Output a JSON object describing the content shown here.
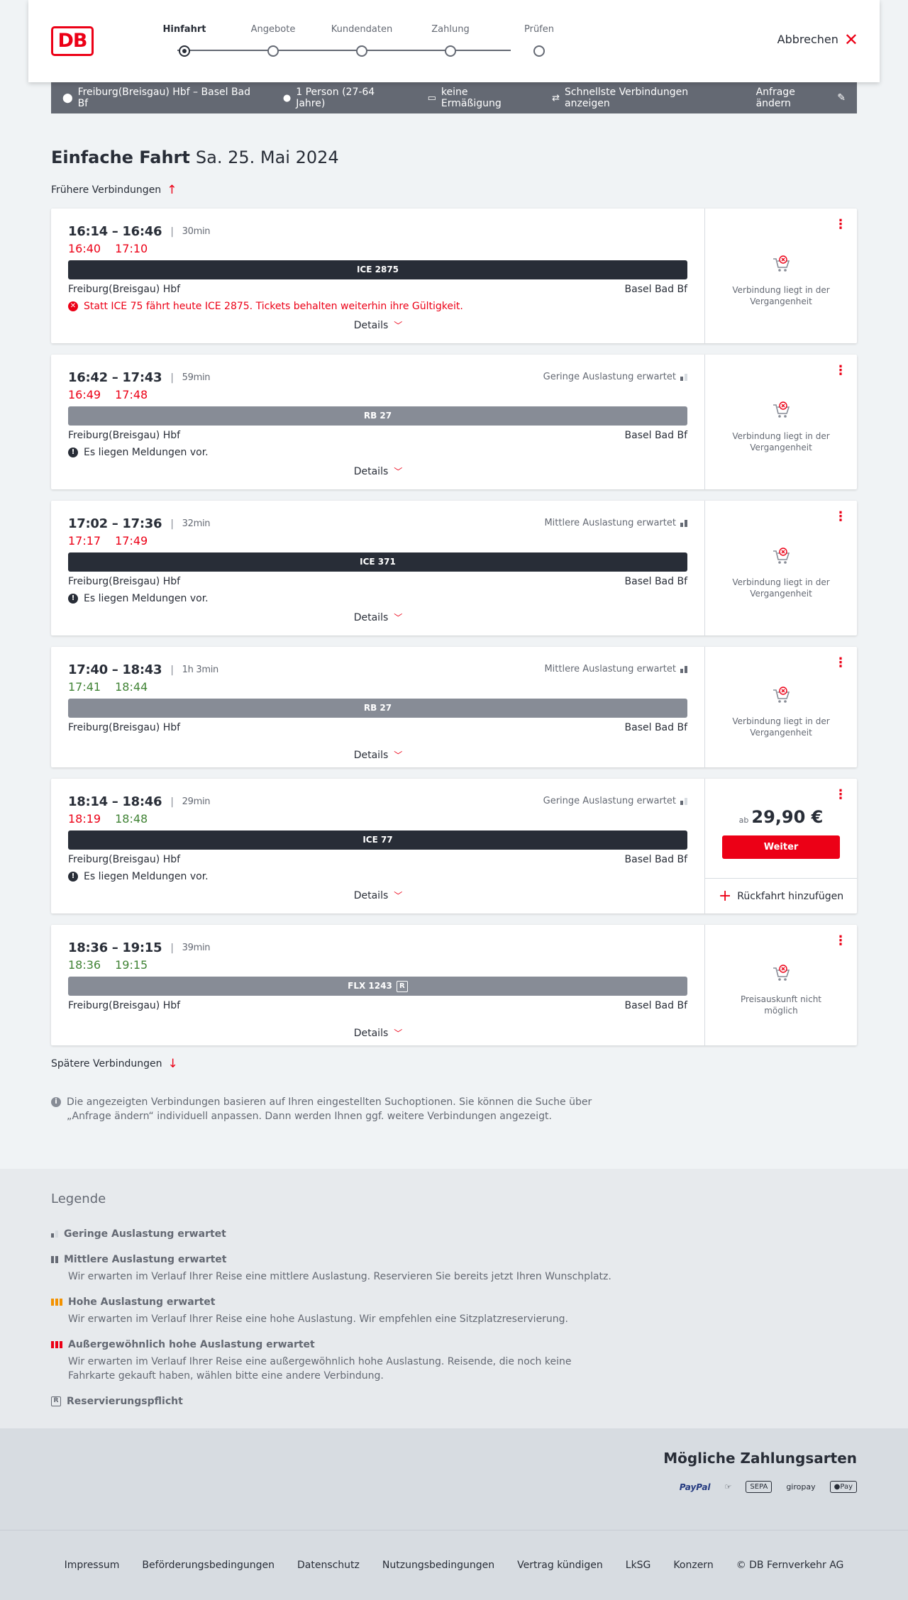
{
  "header": {
    "logo": "DB",
    "steps": [
      "Hinfahrt",
      "Angebote",
      "Kundendaten",
      "Zahlung",
      "Prüfen"
    ],
    "active_step": "Hinfahrt",
    "cancel_label": "Abbrechen"
  },
  "summary": {
    "route": "Freiburg(Breisgau) Hbf – Basel Bad Bf",
    "passengers": "1 Person (27-64 Jahre)",
    "discount": "keine Ermäßigung",
    "fastest": "Schnellste Verbindungen anzeigen",
    "change_label": "Anfrage ändern"
  },
  "page": {
    "title_bold": "Einfache Fahrt",
    "title_date": "Sa. 25. Mai 2024",
    "earlier_label": "Frühere Verbindungen",
    "later_label": "Spätere Verbindungen",
    "info_text": "Die angezeigten Verbindungen basieren auf Ihren eingestellten Suchoptionen. Sie können die Suche über „Anfrage ändern“ individuell anpassen. Dann werden Ihnen ggf. weitere Verbindungen angezeigt."
  },
  "connections": [
    {
      "times": "16:14 – 16:46",
      "duration": "30min",
      "load": "",
      "rt_dep": "16:40",
      "rt_arr": "17:10",
      "rt_dep_color": "red",
      "rt_arr_color": "red",
      "train": "ICE 2875",
      "bar": "dark",
      "reservation": false,
      "from": "Freiburg(Breisgau) Hbf",
      "to": "Basel Bad Bf",
      "message": "Statt ICE 75 fährt heute ICE 2875. Tickets behalten weiterhin ihre Gültigkeit.",
      "message_type": "error",
      "details_label": "Details",
      "status": "Verbindung liegt in der Vergangenheit"
    },
    {
      "times": "16:42 – 17:43",
      "duration": "59min",
      "load": "Geringe Auslastung erwartet",
      "load_level": 1,
      "rt_dep": "16:49",
      "rt_arr": "17:48",
      "rt_dep_color": "red",
      "rt_arr_color": "red",
      "train": "RB 27",
      "bar": "grey",
      "reservation": false,
      "from": "Freiburg(Breisgau) Hbf",
      "to": "Basel Bad Bf",
      "message": "Es liegen Meldungen vor.",
      "message_type": "info",
      "details_label": "Details",
      "status": "Verbindung liegt in der Vergangenheit"
    },
    {
      "times": "17:02 – 17:36",
      "duration": "32min",
      "load": "Mittlere Auslastung erwartet",
      "load_level": 2,
      "rt_dep": "17:17",
      "rt_arr": "17:49",
      "rt_dep_color": "red",
      "rt_arr_color": "red",
      "train": "ICE 371",
      "bar": "dark",
      "reservation": false,
      "from": "Freiburg(Breisgau) Hbf",
      "to": "Basel Bad Bf",
      "message": "Es liegen Meldungen vor.",
      "message_type": "info",
      "details_label": "Details",
      "status": "Verbindung liegt in der Vergangenheit"
    },
    {
      "times": "17:40 – 18:43",
      "duration": "1h 3min",
      "load": "Mittlere Auslastung erwartet",
      "load_level": 2,
      "rt_dep": "17:41",
      "rt_arr": "18:44",
      "rt_dep_color": "green",
      "rt_arr_color": "green",
      "train": "RB 27",
      "bar": "grey",
      "reservation": false,
      "from": "Freiburg(Breisgau) Hbf",
      "to": "Basel Bad Bf",
      "message": "",
      "message_type": "",
      "details_label": "Details",
      "status": "Verbindung liegt in der Vergangenheit"
    },
    {
      "times": "18:14 – 18:46",
      "duration": "29min",
      "load": "Geringe Auslastung erwartet",
      "load_level": 1,
      "rt_dep": "18:19",
      "rt_arr": "18:48",
      "rt_dep_color": "red",
      "rt_arr_color": "green",
      "train": "ICE 77",
      "bar": "dark",
      "reservation": false,
      "from": "Freiburg(Breisgau) Hbf",
      "to": "Basel Bad Bf",
      "message": "Es liegen Meldungen vor.",
      "message_type": "info",
      "details_label": "Details",
      "price_prefix": "ab",
      "price": "29,90 €",
      "button": "Weiter",
      "return_label": "Rückfahrt hinzufügen"
    },
    {
      "times": "18:36 – 19:15",
      "duration": "39min",
      "load": "",
      "rt_dep": "18:36",
      "rt_arr": "19:15",
      "rt_dep_color": "green",
      "rt_arr_color": "green",
      "train": "FLX 1243",
      "bar": "grey",
      "reservation": true,
      "from": "Freiburg(Breisgau) Hbf",
      "to": "Basel Bad Bf",
      "message": "",
      "message_type": "",
      "details_label": "Details",
      "status": "Preisauskunft nicht möglich"
    }
  ],
  "legend": {
    "title": "Legende",
    "items": [
      {
        "title": "Geringe Auslastung erwartet",
        "desc": ""
      },
      {
        "title": "Mittlere Auslastung erwartet",
        "desc": "Wir erwarten im Verlauf Ihrer Reise eine mittlere Auslastung. Reservieren Sie bereits jetzt Ihren Wunschplatz."
      },
      {
        "title": "Hohe Auslastung erwartet",
        "desc": "Wir erwarten im Verlauf Ihrer Reise eine hohe Auslastung. Wir empfehlen eine Sitzplatzreservierung."
      },
      {
        "title": "Außergewöhnlich hohe Auslastung erwartet",
        "desc": "Wir erwarten im Verlauf Ihrer Reise eine außergewöhnlich hohe Auslastung. Reisende, die noch keine Fahrkarte gekauft haben, wählen bitte eine andere Verbindung."
      },
      {
        "title": "Reservierungspflicht",
        "desc": ""
      }
    ]
  },
  "payment": {
    "title": "Mögliche Zahlungsarten",
    "methods": [
      "PayPal",
      "SEPA",
      "giropay",
      "Pay"
    ]
  },
  "footer": {
    "links": [
      "Impressum",
      "Beförderungsbedingungen",
      "Datenschutz",
      "Nutzungsbedingungen",
      "Vertrag kündigen",
      "LkSG",
      "Konzern",
      "© DB Fernverkehr AG"
    ]
  },
  "colors": {
    "accent": "#ec0016",
    "delay": "#ec0016",
    "ontime": "#408335",
    "summary_bar": "#646973"
  }
}
